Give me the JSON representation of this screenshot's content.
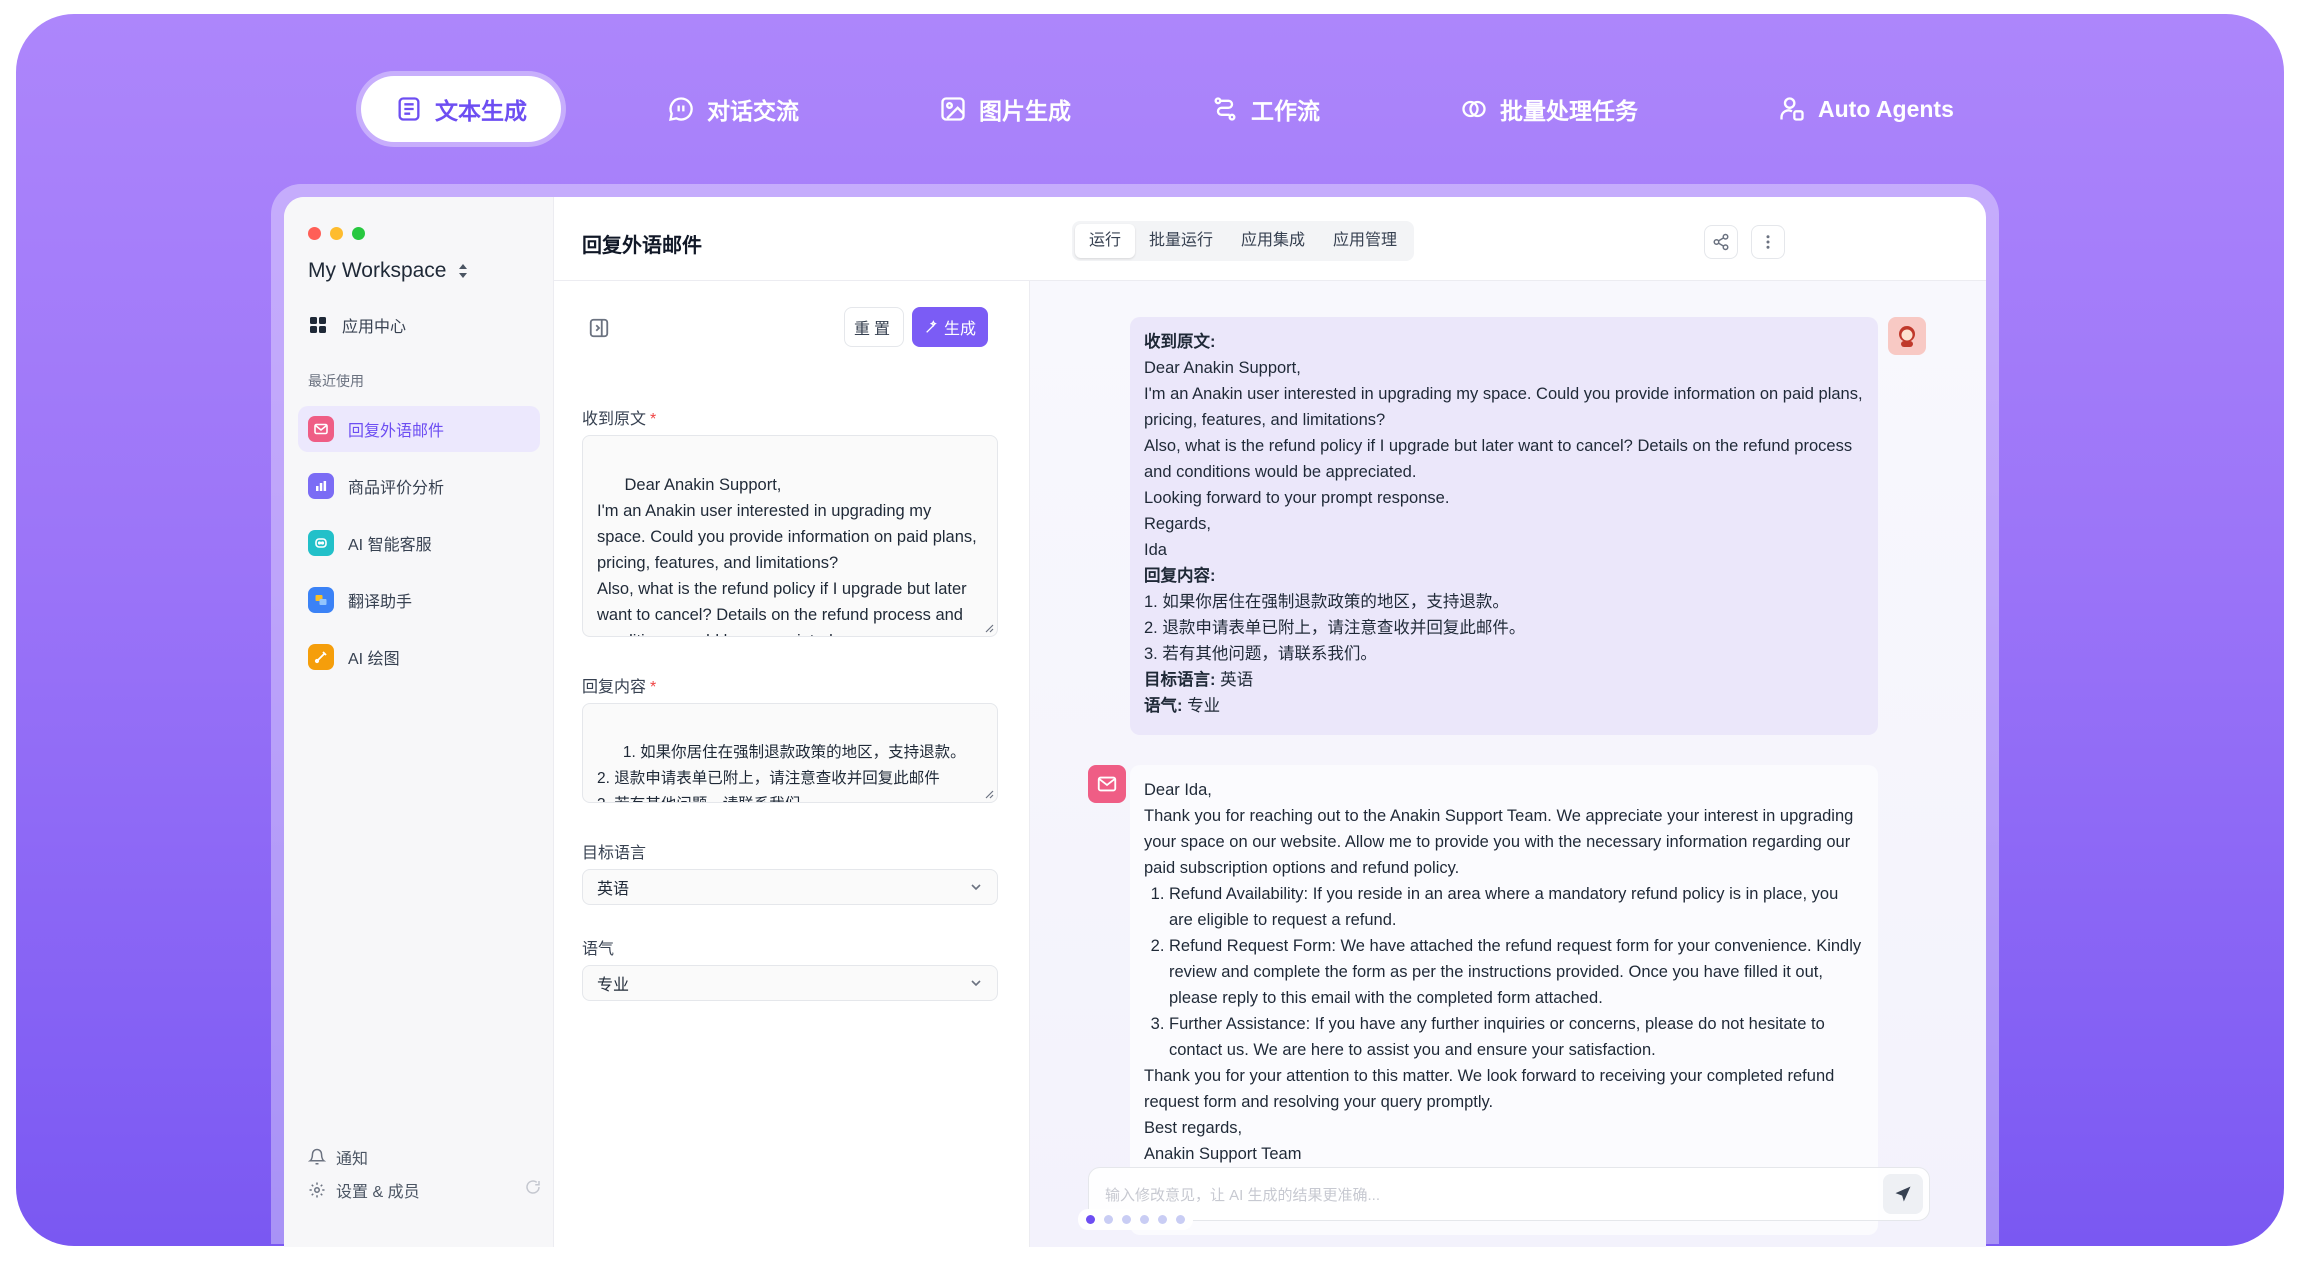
{
  "top_tabs": [
    {
      "label": "文本生成",
      "icon": "document-icon"
    },
    {
      "label": "对话交流",
      "icon": "chat-icon"
    },
    {
      "label": "图片生成",
      "icon": "image-icon"
    },
    {
      "label": "工作流",
      "icon": "workflow-icon"
    },
    {
      "label": "批量处理任务",
      "icon": "batch-icon"
    },
    {
      "label": "Auto Agents",
      "icon": "agents-icon"
    }
  ],
  "sidebar": {
    "workspace": "My Workspace",
    "app_center": "应用中心",
    "recent_label": "最近使用",
    "items": [
      {
        "label": "回复外语邮件",
        "icon": "mail-icon",
        "color": "#ef5d85"
      },
      {
        "label": "商品评价分析",
        "icon": "chart-icon",
        "color": "#7b6cf5"
      },
      {
        "label": "AI 智能客服",
        "icon": "robot-icon",
        "color": "#22c0c9"
      },
      {
        "label": "翻译助手",
        "icon": "translate-icon",
        "color": "#3b82f6"
      },
      {
        "label": "AI 绘图",
        "icon": "paint-icon",
        "color": "#f59e0b"
      }
    ],
    "notify": "通知",
    "settings": "设置 & 成员"
  },
  "header": {
    "title": "回复外语邮件",
    "segments": [
      "运行",
      "批量运行",
      "应用集成",
      "应用管理"
    ]
  },
  "form": {
    "reset_label": "重置",
    "generate_label": "生成",
    "original_label": "收到原文",
    "original_value": "Dear Anakin Support,\nI'm an Anakin user interested in upgrading my space. Could you provide information on paid plans, pricing, features, and limitations?\nAlso, what is the refund policy if I upgrade but later want to cancel? Details on the refund process and conditions would be appreciated....",
    "reply_label": "回复内容",
    "reply_value": "1. 如果你居住在强制退款政策的地区，支持退款。\n2. 退款申请表单已附上，请注意查收并回复此邮件\n3. 若有其他问题，请联系我们。",
    "lang_label": "目标语言",
    "lang_value": "英语",
    "tone_label": "语气",
    "tone_value": "专业"
  },
  "user_message": {
    "heading_original": "收到原文:",
    "lines": [
      "Dear Anakin Support,",
      "I'm an Anakin user interested in upgrading my space. Could you provide information on paid plans, pricing, features, and limitations?",
      "Also, what is the refund policy if I upgrade but later want to cancel? Details on the refund process and conditions would be appreciated.",
      "Looking forward to your prompt response.",
      "Regards,",
      "Ida"
    ],
    "heading_reply": "回复内容:",
    "reply_lines": [
      "1. 如果你居住在强制退款政策的地区，支持退款。",
      "2. 退款申请表单已附上，请注意查收并回复此邮件。",
      "3. 若有其他问题，请联系我们。"
    ],
    "lang_key": "目标语言:",
    "lang_value": "英语",
    "tone_key": "语气:",
    "tone_value": "专业"
  },
  "ai_message": {
    "greeting": "Dear Ida,",
    "intro": "Thank you for reaching out to the Anakin Support Team. We appreciate your interest in upgrading your space on our website. Allow me to provide you with the necessary information regarding our paid subscription options and refund policy.",
    "points": [
      "Refund Availability: If you reside in an area where a mandatory refund policy is in place, you are eligible to request a refund.",
      "Refund Request Form: We have attached the refund request form for your convenience. Kindly review and complete the form as per the instructions provided. Once you have filled it out, please reply to this email with the completed form attached.",
      "Further Assistance: If you have any further inquiries or concerns, please do not hesitate to contact us. We are here to assist you and ensure your satisfaction."
    ],
    "outro": "Thank you for your attention to this matter. We look forward to receiving your completed refund request form and resolving your query promptly.",
    "signoff": "Best regards,",
    "signature": "Anakin Support Team"
  },
  "chat": {
    "placeholder": "输入修改意见，让 AI 生成的结果更准确..."
  },
  "colors": {
    "accent": "#6d4ef2",
    "button": "#7b5cf5"
  }
}
